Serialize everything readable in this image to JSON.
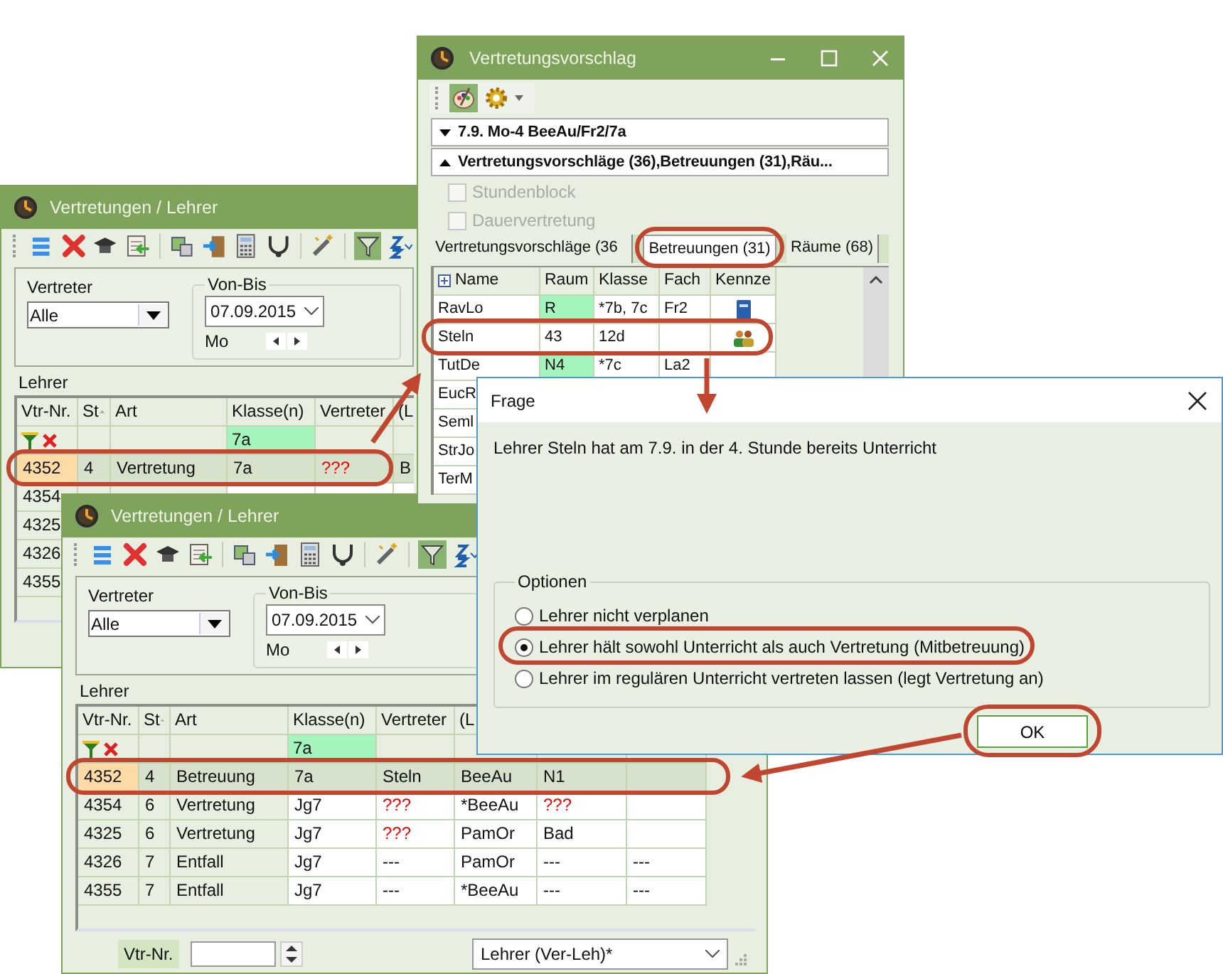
{
  "list_windows": [
    {
      "title": "Vertretungen / Lehrer",
      "filter_on": true,
      "substitute_label": "Vertreter",
      "substitute_value": "Alle",
      "range_label": "Von-Bis",
      "date": "07.09.2015",
      "weekday": "Mo",
      "list_label": "Lehrer",
      "columns": [
        "Vtr-Nr.",
        "St",
        "Art",
        "Klasse(n)",
        "Vertreter",
        "(L"
      ],
      "filter_class": "7a",
      "rows": [
        {
          "selected": true,
          "cells": [
            {
              "text": "4352",
              "alert": false
            },
            {
              "text": "4",
              "alert": false
            },
            {
              "text": "Vertretung",
              "alert": false
            },
            {
              "text": "7a",
              "alert": false
            },
            {
              "text": "???",
              "alert": true
            },
            {
              "text": "B",
              "alert": false
            }
          ]
        },
        {
          "selected": false,
          "cells": [
            {
              "text": "4354",
              "alert": false
            }
          ]
        },
        {
          "selected": false,
          "cells": [
            {
              "text": "4325",
              "alert": false
            }
          ]
        },
        {
          "selected": false,
          "cells": [
            {
              "text": "4326",
              "alert": false
            }
          ]
        },
        {
          "selected": false,
          "cells": [
            {
              "text": "4355",
              "alert": false
            }
          ]
        }
      ]
    },
    {
      "title": "Vertretungen / Lehrer",
      "filter_on": true,
      "substitute_label": "Vertreter",
      "substitute_value": "Alle",
      "range_label": "Von-Bis",
      "date": "07.09.2015",
      "weekday": "Mo",
      "list_label": "Lehrer",
      "columns": [
        "Vtr-Nr.",
        "St",
        "Art",
        "Klasse(n)",
        "Vertreter",
        "(L"
      ],
      "filter_class": "7a",
      "rows": [
        {
          "selected": true,
          "cells": [
            {
              "text": "4352",
              "alert": false
            },
            {
              "text": "4",
              "alert": false
            },
            {
              "text": "Betreuung",
              "alert": false
            },
            {
              "text": "7a",
              "alert": false
            },
            {
              "text": "Steln",
              "alert": false
            },
            {
              "text": "BeeAu",
              "alert": false
            },
            {
              "text": "N1",
              "alert": false
            }
          ]
        },
        {
          "selected": false,
          "cells": [
            {
              "text": "4354",
              "alert": false
            },
            {
              "text": "6",
              "alert": false
            },
            {
              "text": "Vertretung",
              "alert": false
            },
            {
              "text": "Jg7",
              "alert": false
            },
            {
              "text": "???",
              "alert": true
            },
            {
              "text": "*BeeAu",
              "alert": false
            },
            {
              "text": "???",
              "alert": true
            }
          ]
        },
        {
          "selected": false,
          "cells": [
            {
              "text": "4325",
              "alert": false
            },
            {
              "text": "6",
              "alert": false
            },
            {
              "text": "Vertretung",
              "alert": false
            },
            {
              "text": "Jg7",
              "alert": false
            },
            {
              "text": "???",
              "alert": true
            },
            {
              "text": "PamOr",
              "alert": false
            },
            {
              "text": "Bad",
              "alert": false
            }
          ]
        },
        {
          "selected": false,
          "cells": [
            {
              "text": "4326",
              "alert": false
            },
            {
              "text": "7",
              "alert": false
            },
            {
              "text": "Entfall",
              "alert": false
            },
            {
              "text": "Jg7",
              "alert": false
            },
            {
              "text": "---",
              "alert": false
            },
            {
              "text": "PamOr",
              "alert": false
            },
            {
              "text": "---",
              "alert": false
            },
            {
              "text": "---",
              "alert": false
            }
          ]
        },
        {
          "selected": false,
          "cells": [
            {
              "text": "4355",
              "alert": false
            },
            {
              "text": "7",
              "alert": false
            },
            {
              "text": "Entfall",
              "alert": false
            },
            {
              "text": "Jg7",
              "alert": false
            },
            {
              "text": "---",
              "alert": false
            },
            {
              "text": "*BeeAu",
              "alert": false
            },
            {
              "text": "---",
              "alert": false
            },
            {
              "text": "---",
              "alert": false
            }
          ]
        }
      ],
      "footer": {
        "number_label": "Vtr-Nr.",
        "view": "Lehrer (Ver-Leh)*"
      }
    }
  ],
  "proposal_window": {
    "title": "Vertretungsvorschlag",
    "palette_on": true,
    "sections": [
      {
        "label": "7.9. Mo-4 BeeAu/Fr2/7a",
        "expanded": false
      },
      {
        "label": "Vertretungsvorschläge (36),Betreuungen (31),Räu...",
        "expanded": true
      }
    ],
    "options": [
      {
        "label": "Stundenblock",
        "checked": false,
        "disabled": true
      },
      {
        "label": "Dauervertretung",
        "checked": false,
        "disabled": true
      }
    ],
    "tabs": [
      {
        "label": "Vertretungsvorschläge (36",
        "selected": false
      },
      {
        "label": "Betreuungen (31)",
        "selected": true
      },
      {
        "label": "Räume (68)",
        "selected": false
      }
    ],
    "columns": [
      "Name",
      "Raum",
      "Klasse",
      "Fach",
      "Kennze"
    ],
    "rows": [
      {
        "kind": "book",
        "name": "RavLo",
        "room": "R",
        "room_free": true,
        "class": "*7b, 7c",
        "subject": "Fr2"
      },
      {
        "kind": "group",
        "name": "Steln",
        "room": "43",
        "room_free": false,
        "class": "12d"
      },
      {
        "kind": "plain",
        "name": "TutDe",
        "room": "N4",
        "room_free": true,
        "class": "*7c",
        "subject": "La2"
      },
      {
        "kind": "name_only",
        "name": "EucR"
      },
      {
        "kind": "name_only",
        "name": "Seml"
      },
      {
        "kind": "name_only",
        "name": "StrJo"
      },
      {
        "kind": "name_only",
        "name": "TerM"
      }
    ]
  },
  "dialog": {
    "title": "Frage",
    "message": "Lehrer Steln hat am 7.9. in der 4. Stunde bereits Unterricht",
    "group_label": "Optionen",
    "choices": [
      {
        "label": "Lehrer nicht verplanen",
        "selected": false
      },
      {
        "label": "Lehrer hält sowohl Unterricht als auch Vertretung (Mitbetreuung)",
        "selected": true
      },
      {
        "label": "Lehrer im regulären Unterricht vertreten lassen (legt Vertretung an)",
        "selected": false
      }
    ],
    "ok": "OK"
  }
}
